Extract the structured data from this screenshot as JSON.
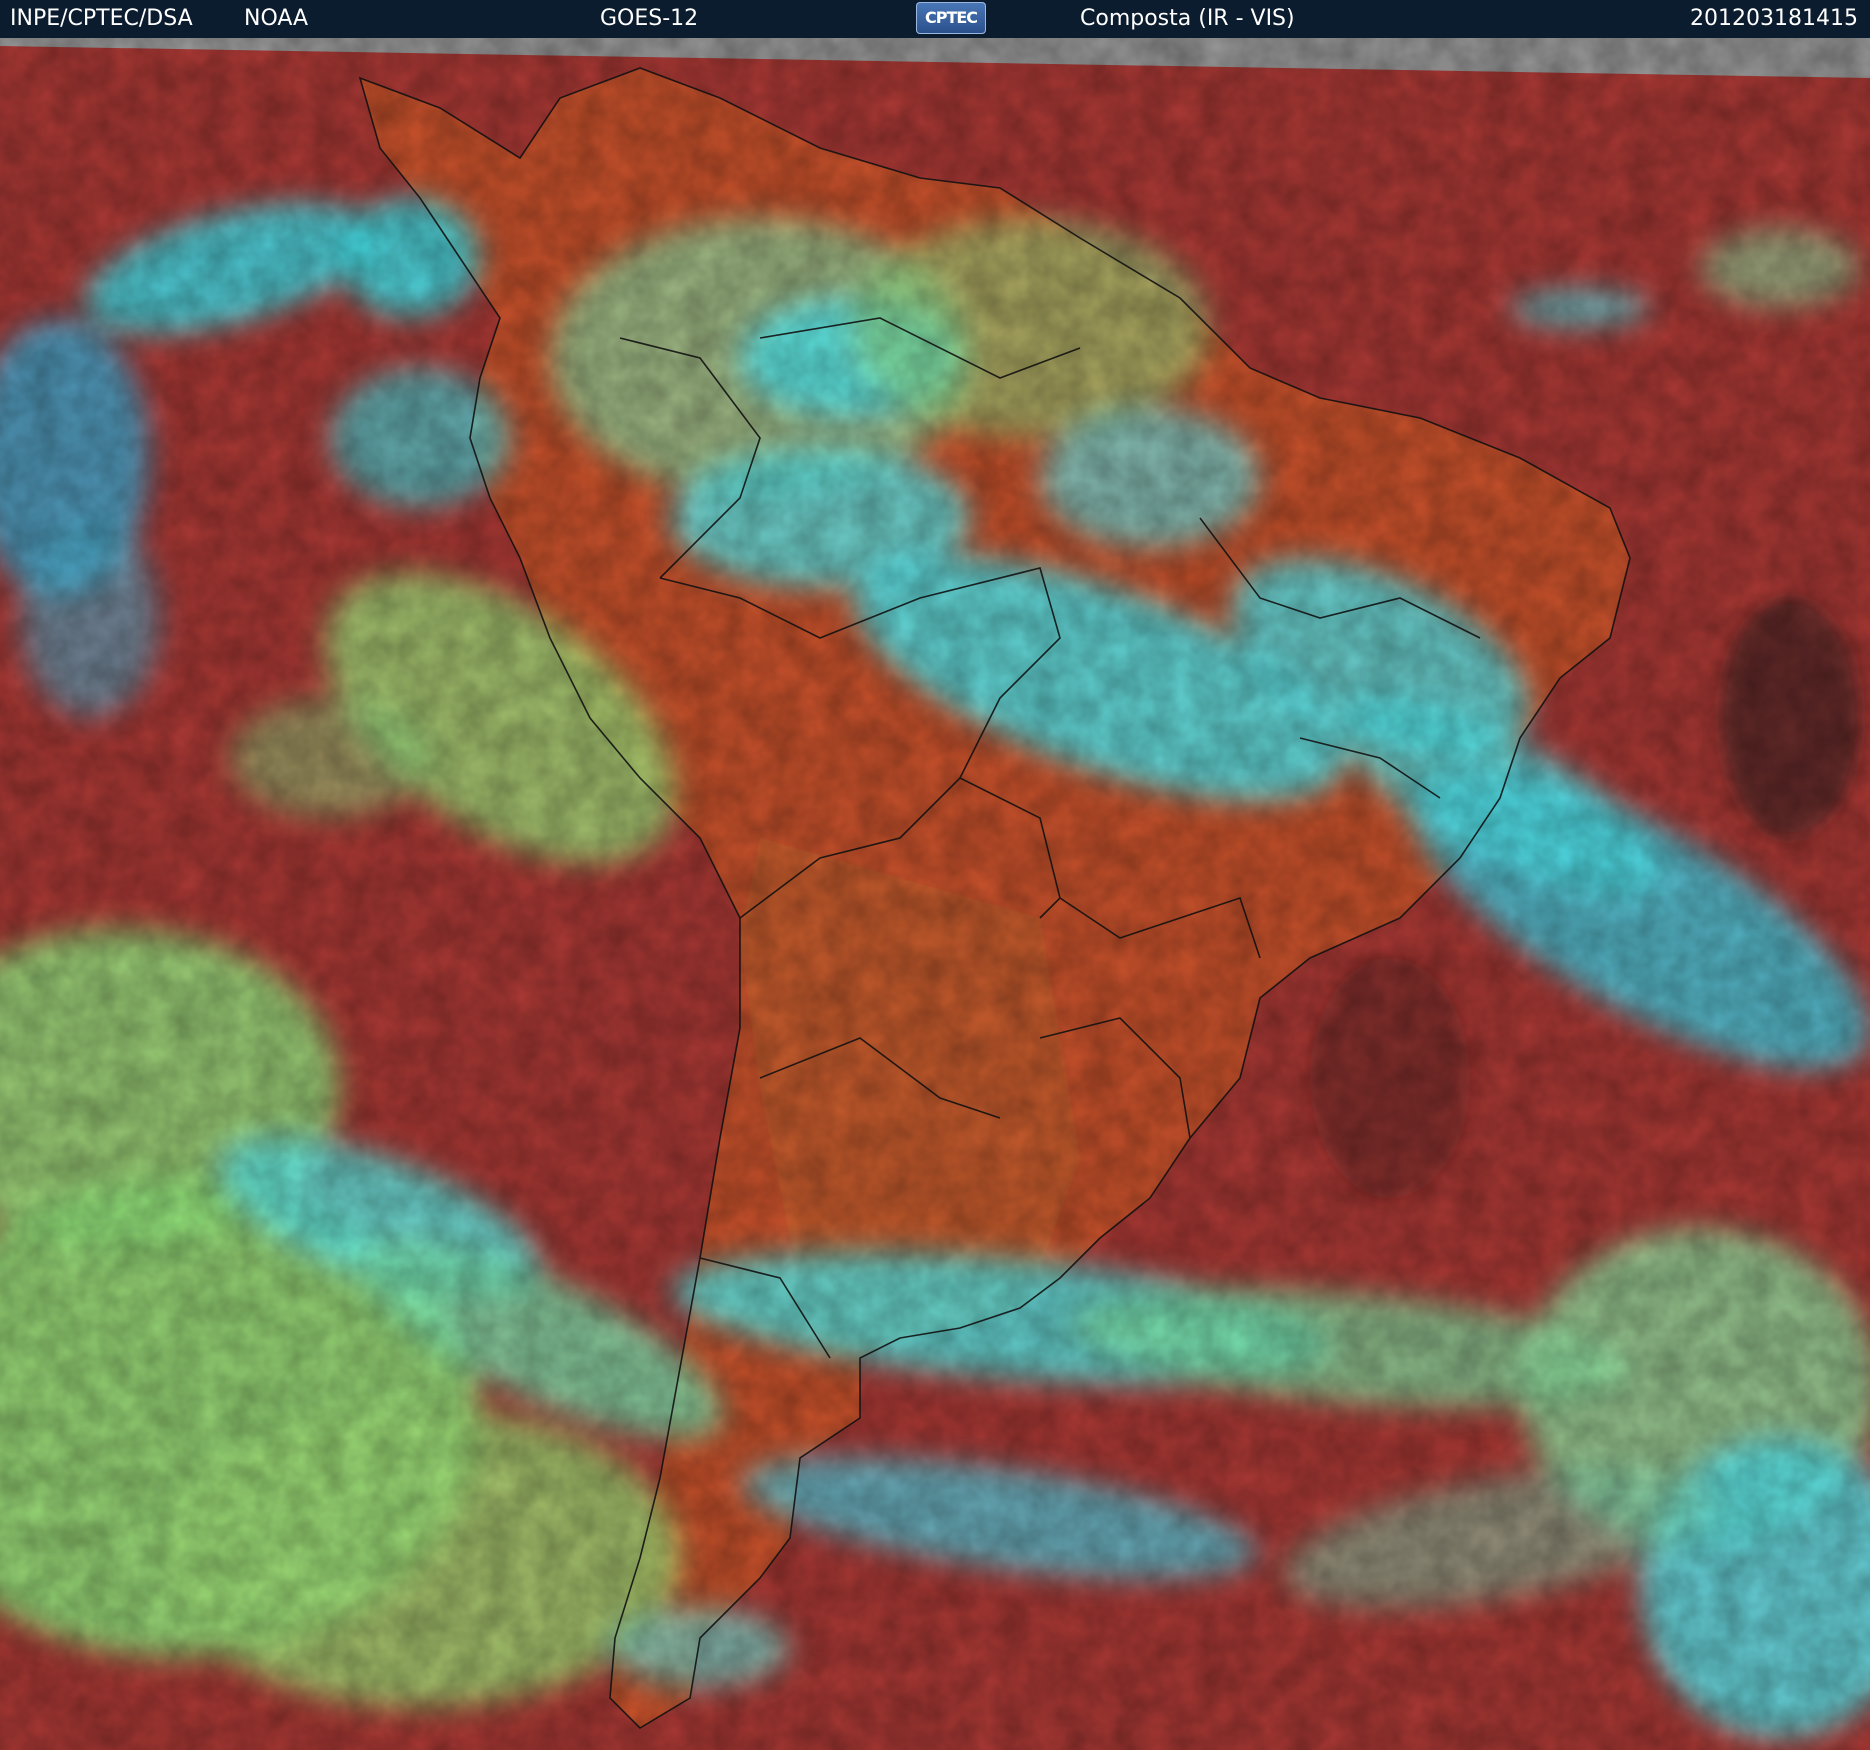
{
  "header": {
    "institution": "INPE/CPTEC/DSA",
    "agency": "NOAA",
    "satellite": "GOES-12",
    "logo_text": "CPTEC",
    "product": "Composta (IR - VIS)",
    "timestamp": "201203181415"
  },
  "colors": {
    "header_bg": "#0b1c2e",
    "ocean_red": "#b43d33",
    "land_orange": "#c9522c",
    "cloud_cyan": "#38e8ef",
    "cloud_green": "#8de57a",
    "border_black": "#111111"
  }
}
